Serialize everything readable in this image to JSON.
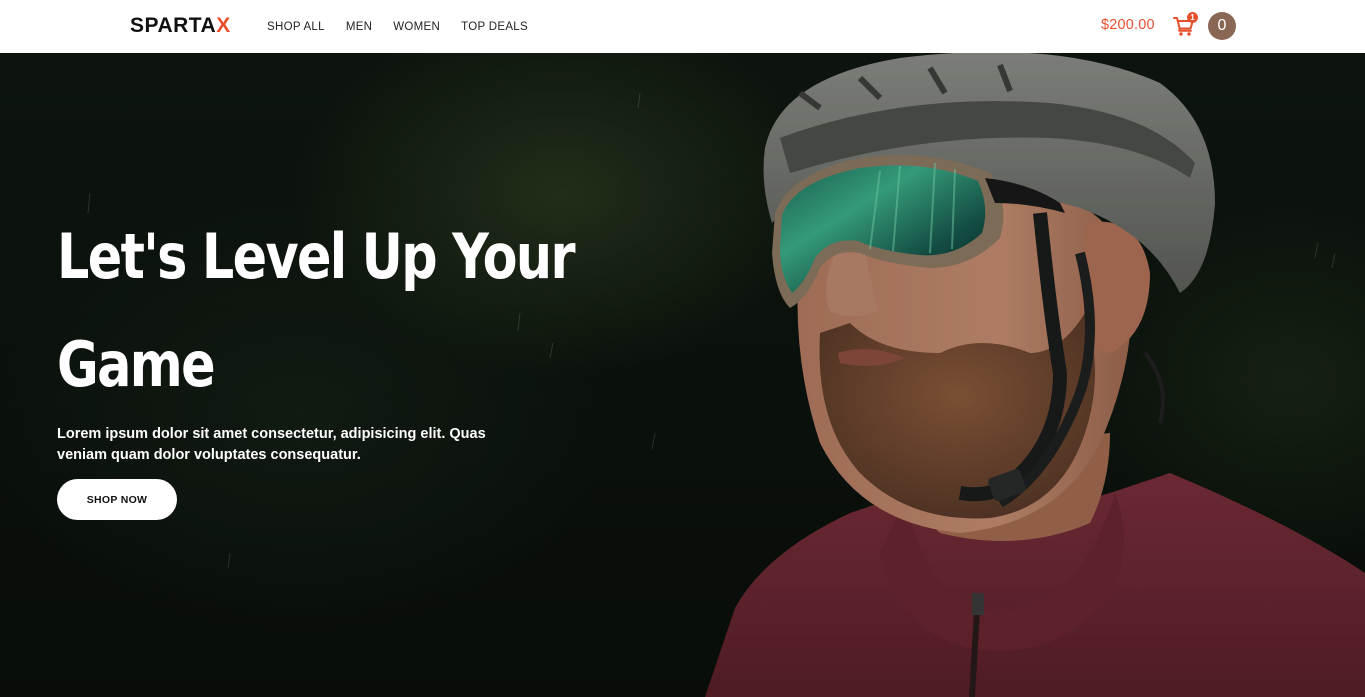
{
  "brand": {
    "name_main": "SPARTA",
    "name_accent": "X",
    "accent_color": "#e8502d"
  },
  "nav": {
    "links": [
      {
        "label": "SHOP ALL"
      },
      {
        "label": "MEN"
      },
      {
        "label": "WOMEN"
      },
      {
        "label": "TOP DEALS"
      }
    ]
  },
  "cart": {
    "total": "$200.00",
    "count": "1",
    "icon": "cart-icon"
  },
  "user": {
    "avatar_initial": "0",
    "avatar_color": "#8a6654"
  },
  "hero": {
    "title_line1": "Let's Level Up Your",
    "title_line2": "Game",
    "subtitle": "Lorem ipsum dolor sit amet consectetur, adipisicing elit. Quas veniam quam dolor voluptates consequatur.",
    "cta_label": "SHOP NOW",
    "image_subject": "cyclist-with-helmet-and-sunglasses"
  }
}
